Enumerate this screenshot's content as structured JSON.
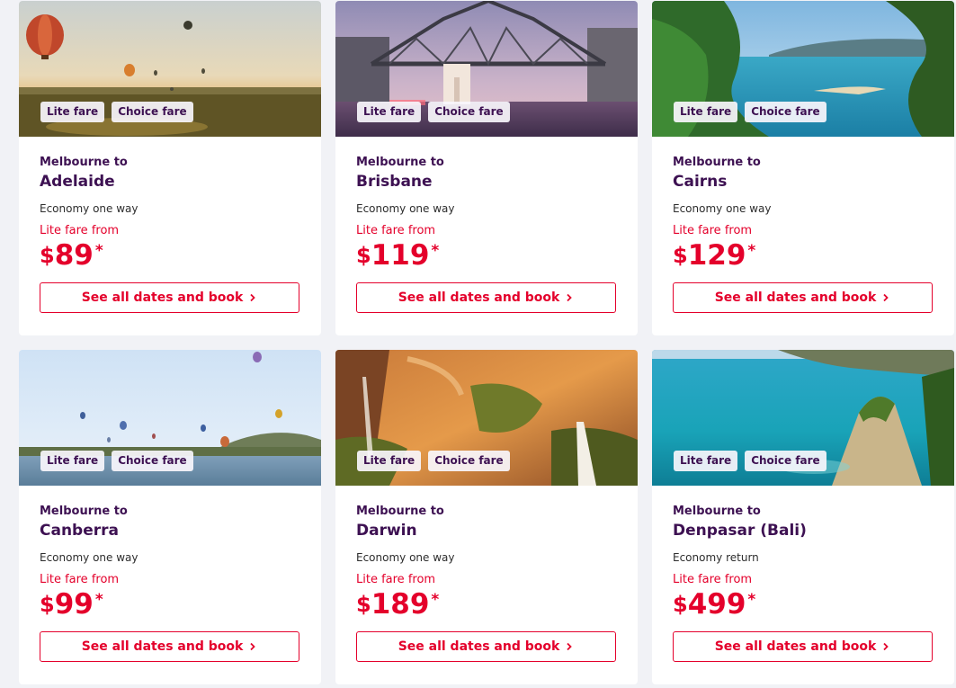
{
  "colors": {
    "brand_purple": "#3d1152",
    "accent_red": "#e4002b",
    "card_bg": "#ffffff",
    "page_bg": "#f1f2f6"
  },
  "cards": [
    {
      "from_label": "Melbourne to",
      "destination": "Adelaide",
      "cabin": "Economy one way",
      "fare_label": "Lite fare from",
      "currency": "$",
      "price": "89",
      "asterisk": "*",
      "tags": [
        "Lite fare",
        "Choice fare"
      ],
      "button_label": "See all dates and book",
      "image": "hot-air-balloons-over-field-sunset"
    },
    {
      "from_label": "Melbourne to",
      "destination": "Brisbane",
      "cabin": "Economy one way",
      "fare_label": "Lite fare from",
      "currency": "$",
      "price": "119",
      "asterisk": "*",
      "tags": [
        "Lite fare",
        "Choice fare"
      ],
      "button_label": "See all dates and book",
      "image": "story-bridge-dusk"
    },
    {
      "from_label": "Melbourne to",
      "destination": "Cairns",
      "cabin": "Economy one way",
      "fare_label": "Lite fare from",
      "currency": "$",
      "price": "129",
      "asterisk": "*",
      "tags": [
        "Lite fare",
        "Choice fare"
      ],
      "button_label": "See all dates and book",
      "image": "tropical-coastline"
    },
    {
      "from_label": "Melbourne to",
      "destination": "Canberra",
      "cabin": "Economy one way",
      "fare_label": "Lite fare from",
      "currency": "$",
      "price": "99",
      "asterisk": "*",
      "tags": [
        "Lite fare",
        "Choice fare"
      ],
      "button_label": "See all dates and book",
      "image": "balloons-over-lake"
    },
    {
      "from_label": "Melbourne to",
      "destination": "Darwin",
      "cabin": "Economy one way",
      "fare_label": "Lite fare from",
      "currency": "$",
      "price": "189",
      "asterisk": "*",
      "tags": [
        "Lite fare",
        "Choice fare"
      ],
      "button_label": "See all dates and book",
      "image": "gorge-waterfall"
    },
    {
      "from_label": "Melbourne to",
      "destination": "Denpasar (Bali)",
      "cabin": "Economy return",
      "fare_label": "Lite fare from",
      "currency": "$",
      "price": "499",
      "asterisk": "*",
      "tags": [
        "Lite fare",
        "Choice fare"
      ],
      "button_label": "See all dates and book",
      "image": "bali-cliffs-turquoise-sea"
    }
  ]
}
